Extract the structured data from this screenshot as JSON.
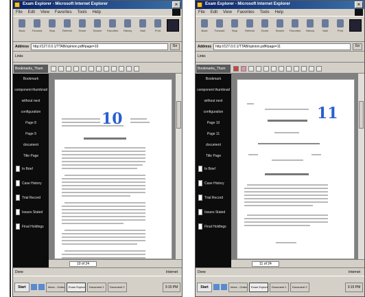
{
  "panels": [
    {
      "window_title": "Exam Explorer - Microsoft Internet Explorer",
      "menu": [
        "File",
        "Edit",
        "View",
        "Favorites",
        "Tools",
        "Help"
      ],
      "toolbar": [
        "Back",
        "Forward",
        "Stop",
        "Refresh",
        "Home",
        "Search",
        "Favorites",
        "History",
        "Mail",
        "Print",
        "Edit"
      ],
      "address_label": "Address",
      "address_value": "http://127.0.0.1/TTAB/opinion.pdf#page=10",
      "go_label": "Go",
      "links_label": "Links",
      "sidebar_header": "Bookmarks_Thum",
      "sidebar_items": [
        "Bookmark",
        "component thumbnail",
        "without next",
        "configuration",
        "Page 8",
        "Page 9",
        "document",
        "Title Page"
      ],
      "bookmarks": [
        "In Brief",
        "Case History",
        "Trial Record",
        "Issues Stated",
        "Final Holdings"
      ],
      "page_number": "10",
      "page_field": "10 of 24",
      "status_left": "Done",
      "status_right": "Internet",
      "taskbar": [
        "Start",
        "Inbox - Outlook",
        "Exam Explorer",
        "Document 1",
        "Document 2"
      ],
      "tray": "3:15 PM"
    },
    {
      "window_title": "Exam Explorer - Microsoft Internet Explorer",
      "menu": [
        "File",
        "Edit",
        "View",
        "Favorites",
        "Tools",
        "Help"
      ],
      "toolbar": [
        "Back",
        "Forward",
        "Stop",
        "Refresh",
        "Home",
        "Search",
        "Favorites",
        "History",
        "Mail",
        "Print",
        "Edit"
      ],
      "address_label": "Address",
      "address_value": "http://127.0.0.1/TTAB/opinion.pdf#page=11",
      "go_label": "Go",
      "links_label": "Links",
      "sidebar_header": "Bookmarks_Thum",
      "sidebar_items": [
        "Bookmark",
        "component thumbnail",
        "without next",
        "configuration",
        "Page 10",
        "Page 11",
        "document",
        "Title Page"
      ],
      "bookmarks": [
        "In Brief",
        "Case History",
        "Trial Record",
        "Issues Stated",
        "Final Holdings"
      ],
      "page_number": "11",
      "page_field": "11 of 24",
      "status_left": "Done",
      "status_right": "Internet",
      "taskbar": [
        "Start",
        "Inbox - Outlook",
        "Exam Explorer",
        "Document 1",
        "Document 2"
      ],
      "tray": "3:15 PM"
    }
  ],
  "colors": {
    "title_gradient_start": "#0a246a",
    "title_gradient_end": "#3a6ea5",
    "page_number": "#2a5fd0",
    "sidebar_bg": "#0c0c0c"
  }
}
